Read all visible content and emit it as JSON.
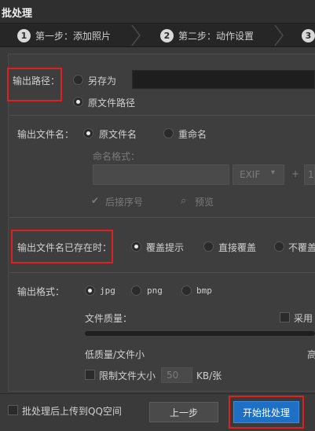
{
  "window": {
    "title": "批处理"
  },
  "steps": [
    {
      "num": "1",
      "label": "第一步：添加照片"
    },
    {
      "num": "2",
      "label": "第二步：动作设置"
    },
    {
      "num": "3",
      "label": ""
    }
  ],
  "output_path": {
    "label": "输出路径：",
    "option_save_as": "另存为",
    "option_original": "原文件路径",
    "selected": "原文件路径"
  },
  "output_filename": {
    "label": "输出文件名：",
    "option_original": "原文件名",
    "option_rename": "重命名",
    "selected": "原文件名",
    "naming_format_label": "命名格式：",
    "exif_label": "EXIF",
    "plus": "+",
    "num_partial": "1",
    "append_seq_label": "后接序号",
    "preview_label": "预览"
  },
  "exists": {
    "label": "输出文件名已存在时：",
    "option_prompt": "覆盖提示",
    "option_overwrite": "直接覆盖",
    "option_no_overwrite": "不覆盖",
    "selected": "覆盖提示"
  },
  "format": {
    "label": "输出格式：",
    "options": [
      "jpg",
      "png",
      "bmp"
    ],
    "selected": "jpg",
    "quality_label": "文件质量：",
    "use_label_partial": "采用",
    "low_label": "低质量/文件小",
    "high_partial": "高",
    "limit_label": "限制文件大小",
    "limit_value": "50",
    "limit_unit": "KB/张"
  },
  "footer": {
    "upload_label": "批处理后上传到QQ空间",
    "prev_button": "上一步",
    "start_button": "开始批处理"
  },
  "colors": {
    "highlight": "#e02020",
    "accent": "#1f6fc4"
  }
}
